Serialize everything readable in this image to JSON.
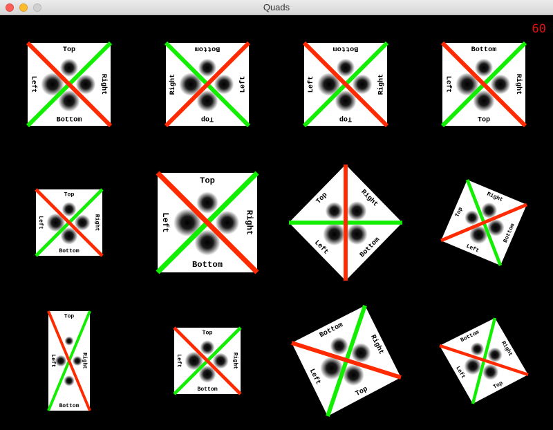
{
  "window": {
    "title": "Quads"
  },
  "hud": {
    "fps": "60"
  },
  "colors": {
    "red": "#ff2a00",
    "green": "#11ee00",
    "blob": "#000000",
    "panel": "#ffffff",
    "background": "#000000"
  },
  "quad_label_set": {
    "top": "Top",
    "bottom": "Bottom",
    "left": "Left",
    "right": "Right"
  },
  "quads": [
    {
      "name": "quad-1"
    },
    {
      "name": "quad-2"
    },
    {
      "name": "quad-3"
    },
    {
      "name": "quad-4"
    },
    {
      "name": "quad-5"
    },
    {
      "name": "quad-6"
    },
    {
      "name": "quad-7"
    },
    {
      "name": "quad-8"
    },
    {
      "name": "quad-9"
    },
    {
      "name": "quad-10"
    },
    {
      "name": "quad-11"
    },
    {
      "name": "quad-12"
    }
  ]
}
